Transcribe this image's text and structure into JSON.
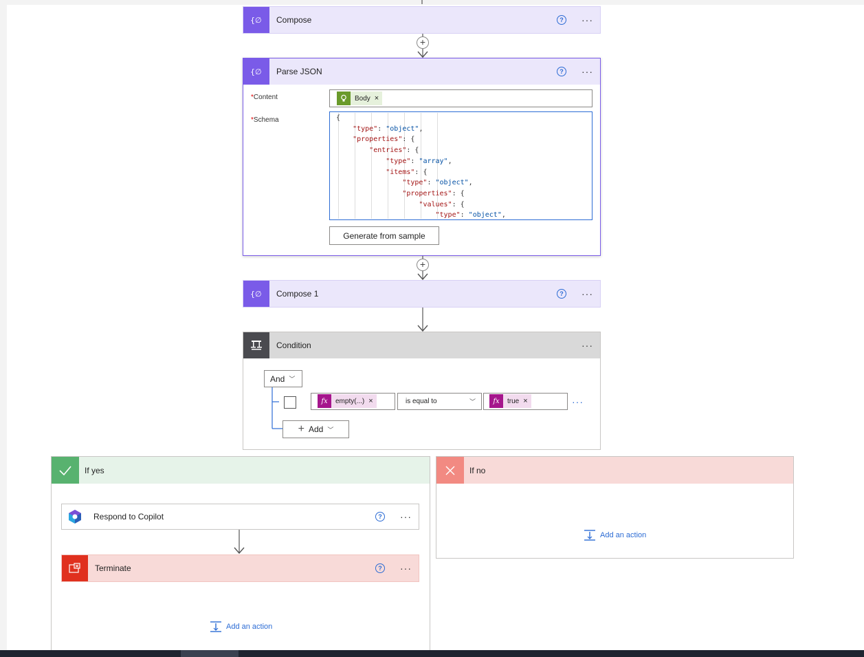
{
  "steps": {
    "compose": {
      "title": "Compose"
    },
    "parse_json": {
      "title": "Parse JSON",
      "content_label": "Content",
      "schema_label": "Schema",
      "required_mark": "*",
      "content_token": "Body",
      "schema_lines": [
        "{",
        "    \"type\": \"object\",",
        "    \"properties\": {",
        "        \"entries\": {",
        "            \"type\": \"array\",",
        "            \"items\": {",
        "                \"type\": \"object\",",
        "                \"properties\": {",
        "                    \"values\": {",
        "                        \"type\": \"object\","
      ],
      "generate_button": "Generate from sample"
    },
    "compose1": {
      "title": "Compose 1"
    },
    "condition": {
      "title": "Condition",
      "group_operator": "And",
      "left_token": "empty(...)",
      "operator": "is equal to",
      "right_token": "true",
      "add_label": "Add",
      "fx_label": "fx"
    }
  },
  "branches": {
    "yes": {
      "title": "If yes",
      "actions": [
        {
          "title": "Respond to Copilot"
        },
        {
          "title": "Terminate"
        }
      ],
      "add_action": "Add an action"
    },
    "no": {
      "title": "If no",
      "add_action": "Add an action"
    }
  },
  "icons": {
    "compose": "braces-icon",
    "help": "help-icon",
    "more": "more-icon",
    "condition": "condition-icon",
    "yes": "check-icon",
    "no": "x-icon",
    "copilot": "copilot-icon",
    "terminate": "terminate-icon",
    "add_action": "add-action-icon"
  },
  "colors": {
    "action_purple": "#7a5be8",
    "action_header": "#ebe7fb",
    "condition_dark": "#4a4a4f",
    "yes_green": "#58b26f",
    "no_salmon": "#f28a82",
    "terminate_red": "#e0301e",
    "link_blue": "#2b6bd4",
    "expression_magenta": "#a5168c"
  }
}
